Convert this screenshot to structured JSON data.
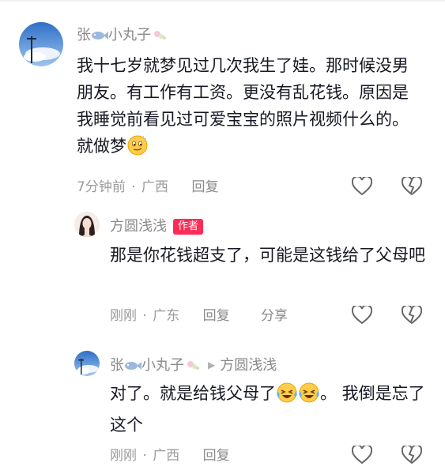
{
  "comments": [
    {
      "author": "张",
      "author_suffix": "小丸子",
      "text": "我十七岁就梦见过几次我生了娃。那时候没男朋友。有工作有工资。更没有乱花钱。原因是我睡觉前看见过可爱宝宝的照片视频什么的。就做梦",
      "time": "7分钟前",
      "location": "广西",
      "reply_label": "回复"
    },
    {
      "author": "方圆浅浅",
      "badge": "作者",
      "text": "那是你花钱超支了，可能是这钱给了父母吧",
      "time": "刚刚",
      "location": "广东",
      "reply_label": "回复",
      "share_label": "分享"
    },
    {
      "author": "张",
      "author_suffix": "小丸子",
      "reply_to": "方圆浅浅",
      "text_before": "对了。就是给钱父母了",
      "text_after": "。 我倒是忘了这个",
      "time": "刚刚",
      "location": "广西",
      "reply_label": "回复"
    }
  ],
  "meta_separator": "·",
  "colors": {
    "badge": "#fe2c55",
    "muted": "#9a9a9a",
    "text": "#161823"
  }
}
